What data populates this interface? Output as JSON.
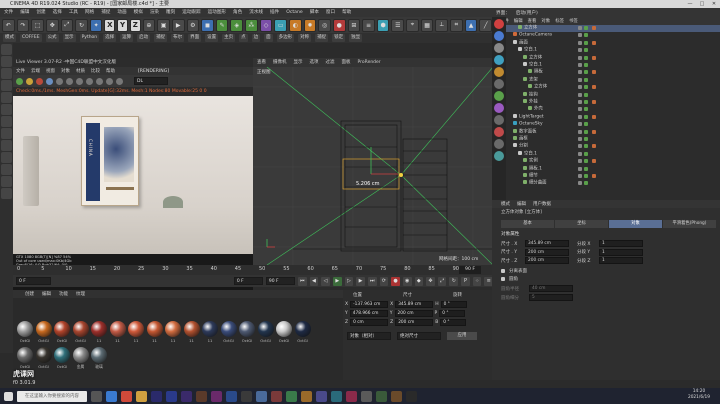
{
  "window": {
    "title": "CINEMA 4D R19.024 Studio (RC - R19) - [国家邮局楼.c4d *] - 主要",
    "min": "—",
    "max": "□",
    "close": "✕"
  },
  "menu": [
    "文件",
    "编辑",
    "创建",
    "选择",
    "工具",
    "网格",
    "捕捉",
    "动画",
    "模拟",
    "渲染",
    "雕刻",
    "运动跟踪",
    "运动图形",
    "角色",
    "流水线",
    "插件",
    "Octane",
    "脚本",
    "窗口",
    "帮助"
  ],
  "right_menu": [
    "界面：",
    "启动(用户)"
  ],
  "toolbar2": [
    "模式",
    "COFFEE",
    "公式",
    "显示",
    "Python",
    "选择",
    "运算",
    "启动",
    "捕捉",
    "布尔",
    "界面",
    "设置",
    "主页",
    "点",
    "边",
    "面",
    "多边形",
    "对称",
    "捕捉",
    "锁定",
    "独显"
  ],
  "liveviewer": {
    "title": "Live Viewer 3.07-R2 -中国C4D联盟中文汉化版",
    "menu": [
      "文件",
      "云端",
      "视窗",
      "对象",
      "材质",
      "比较",
      "帮助"
    ],
    "tag": "[RENDERING]",
    "mode": "DL",
    "status": "Check:0ms./1ms. MeshGen:0ms. Update[G]:32ms. Mesh:1 Nodes:80 Movable:25  0 0",
    "info": [
      "GTX 1080 8GB(T)[N]  %87  54%",
      "Out of core used/max:0Kb/4Gb",
      "Grey8/16: 0/0   Rgb32/64: 0/0",
      "Used/free/total vram: 3694Mb/4.0Gb/8Gb",
      "Rendering: 0%  Ms/sec: 0.00  Time: 00:00:00/00:00:00  Spp/maxspp: 0/280  Tri: 1m  Mesh: 21  Hair: 0"
    ],
    "poster_text": "CHINA"
  },
  "viewport": {
    "menu": [
      "查看",
      "摄像机",
      "显示",
      "选项",
      "过滤",
      "面板",
      "ProRender"
    ],
    "label": "正视图",
    "dimension": "5.206 cm",
    "grid": "网格间距：100 cm"
  },
  "timeline": {
    "ticks": [
      "0",
      "5",
      "10",
      "15",
      "20",
      "25",
      "30",
      "35",
      "40",
      "45",
      "50",
      "55",
      "60",
      "65",
      "70",
      "75",
      "80",
      "85",
      "90"
    ],
    "current_frame": "90 F",
    "start_field": "0 F",
    "end_field": "90 F",
    "mini_field": "0 F"
  },
  "materials": {
    "menu": [
      "创建",
      "编辑",
      "功能",
      "纹理"
    ],
    "row1": [
      {
        "label": "OctGl",
        "color": "#9e9e9e"
      },
      {
        "label": "OctGl",
        "color": "#c7691f"
      },
      {
        "label": "OctGl",
        "color": "#b2432a"
      },
      {
        "label": "OctGl",
        "color": "#a8452e"
      },
      {
        "label": "11",
        "color": "#9d2f2a"
      },
      {
        "label": "11",
        "color": "#c25a45"
      },
      {
        "label": "11",
        "color": "#d05a3a"
      },
      {
        "label": "11",
        "color": "#c45731"
      },
      {
        "label": "11",
        "color": "#d26c3f"
      },
      {
        "label": "11",
        "color": "#b3512f"
      },
      {
        "label": "11",
        "color": "#2d3a5a"
      },
      {
        "label": "OctGl",
        "color": "#3a4c7a"
      },
      {
        "label": "OctGl",
        "color": "#4e5a72"
      },
      {
        "label": "OctGl",
        "color": "#22354e"
      },
      {
        "label": "OctGl",
        "color": "#c9c9c9"
      },
      {
        "label": "OctGl",
        "color": "#1e2a44"
      }
    ],
    "row2": [
      {
        "label": "OctGl",
        "color": "#6a6a6a"
      },
      {
        "label": "OctGl",
        "color": "#37332d"
      },
      {
        "label": "OctGl",
        "color": "#2f6f7a"
      },
      {
        "label": "金属",
        "color": "#8a8a8a"
      },
      {
        "label": "玻璃",
        "color": "#5c6b73"
      }
    ]
  },
  "coords": {
    "headers": [
      "位置",
      "尺寸",
      "旋转"
    ],
    "rows": [
      {
        "axis": "X",
        "pos": "-137.963 cm",
        "size": "345.89 cm",
        "rlabel": "H",
        "rot": "0 °"
      },
      {
        "axis": "Y",
        "pos": "478.966 cm",
        "size": "200 cm",
        "rlabel": "P",
        "rot": "0 °"
      },
      {
        "axis": "Z",
        "pos": "0 cm",
        "size": "200 cm",
        "rlabel": "B",
        "rot": "0 °"
      }
    ],
    "mode_obj": "对象（相对）",
    "mode_size": "绝对尺寸",
    "apply": "应用"
  },
  "objects": {
    "header": [
      "文件",
      "编辑",
      "查看",
      "对象",
      "标签",
      "书签"
    ],
    "rows": [
      {
        "name": "立方体",
        "type": "cube",
        "indent": 2,
        "selected": true
      },
      {
        "name": "OctaneCamera",
        "type": "cam",
        "indent": 1
      },
      {
        "name": "画面",
        "type": "null",
        "indent": 1
      },
      {
        "name": "空白.1",
        "type": "null",
        "indent": 2
      },
      {
        "name": "立方体",
        "type": "cube",
        "indent": 3
      },
      {
        "name": "空白.1",
        "type": "null",
        "indent": 3
      },
      {
        "name": "隔板",
        "type": "cube",
        "indent": 4
      },
      {
        "name": "支架",
        "type": "cube",
        "indent": 3
      },
      {
        "name": "立方体",
        "type": "cube",
        "indent": 4
      },
      {
        "name": "挂钩",
        "type": "cube",
        "indent": 3
      },
      {
        "name": "外挂",
        "type": "cube",
        "indent": 3
      },
      {
        "name": "外壳",
        "type": "cube",
        "indent": 4
      },
      {
        "name": "LightTarget",
        "type": "null",
        "indent": 1
      },
      {
        "name": "OctaneSky",
        "type": "oct",
        "indent": 1
      },
      {
        "name": "数字面板",
        "type": "cube",
        "indent": 1
      },
      {
        "name": "画框",
        "type": "cube",
        "indent": 1
      },
      {
        "name": "分割",
        "type": "null",
        "indent": 1
      },
      {
        "name": "空白.1",
        "type": "null",
        "indent": 2
      },
      {
        "name": "实例",
        "type": "cube",
        "indent": 3
      },
      {
        "name": "隔板.1",
        "type": "cube",
        "indent": 3
      },
      {
        "name": "细节",
        "type": "cube",
        "indent": 3
      },
      {
        "name": "细分曲面",
        "type": "cube",
        "indent": 3
      }
    ]
  },
  "attributes": {
    "menu": [
      "模式",
      "编辑",
      "用户数据"
    ],
    "title": "立方体对象 [立方体]",
    "tabs": [
      "基本",
      "坐标",
      "对象",
      "平滑着色(Phong)"
    ],
    "active_tab": 2,
    "section": "对象属性",
    "rows": [
      {
        "label": "尺寸 . X",
        "value": "345.89 cm",
        "seg_label": "分段 X",
        "seg": "1"
      },
      {
        "label": "尺寸 . Y",
        "value": "200 cm",
        "seg_label": "分段 Y",
        "seg": "1"
      },
      {
        "label": "尺寸 . Z",
        "value": "200 cm",
        "seg_label": "分段 Z",
        "seg": "1"
      }
    ],
    "separate": "分离表面",
    "fillet": "圆角",
    "fillet_radius_label": "圆角半径",
    "fillet_radius": "40 cm",
    "fillet_sub_label": "圆角细分",
    "fillet_sub": "5"
  },
  "watermark": {
    "logo": "虎课网",
    "id": "f0 3.01.9"
  },
  "taskbar": {
    "search": "在这里输入你要搜索的内容",
    "time": "14:20",
    "date": "2021/6/19"
  }
}
